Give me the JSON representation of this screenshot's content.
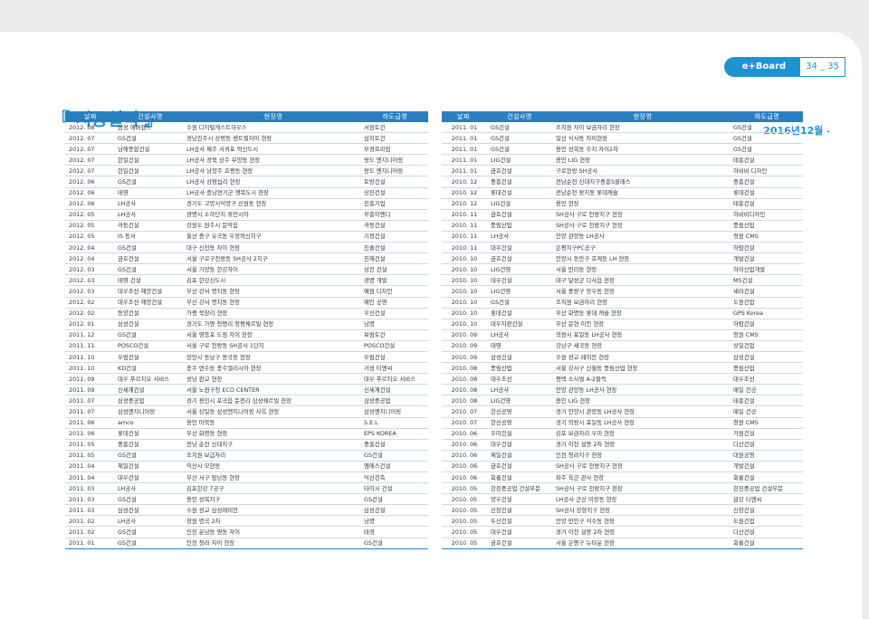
{
  "header": {
    "brand": "e+Board",
    "pages": "34 _ 35"
  },
  "title": "『 시공실적 』",
  "date": {
    "year": "2016년",
    "month": "12월",
    "suffix": "-"
  },
  "columns": [
    "날짜",
    "건설사명",
    "현장명",
    "하도급명"
  ],
  "left_rows": [
    [
      "2012. 08",
      "삼성 에버랜드",
      "수원 디지털게스트하우스",
      "서원토건"
    ],
    [
      "2012. 07",
      "GS건설",
      "경남진주시 상평동 센트럴자이 현장",
      "삼지토건"
    ],
    [
      "2012. 07",
      "남해종합건설",
      "LH공사 제주 서귀포 혁신도시",
      "부경프라임"
    ],
    [
      "2012. 07",
      "한일건설",
      "LH공사 경북 상주 무양동 현장",
      "왕도 엔지니어링"
    ],
    [
      "2012. 07",
      "한일건설",
      "LH공사 남양주 호평동 현장",
      "왕도 엔지니어링"
    ],
    [
      "2012. 06",
      "GS건설",
      "LH공사 상왕십리 현장",
      "토방건설"
    ],
    [
      "2012. 06",
      "태영",
      "LH공사 충남연기군 행복도시 현장",
      "상진건설"
    ],
    [
      "2012. 06",
      "LH공사",
      "경기도 고양시덕양구 신원동 현장",
      "진흥기업"
    ],
    [
      "2012. 05",
      "LH공사",
      "광명시 소하단지 휴먼시아",
      "부흥이엔디"
    ],
    [
      "2012. 05",
      "극동건설",
      "강원도 원주시 문막읍",
      "극동건설"
    ],
    [
      "2012. 05",
      "IS 동서",
      "울산 중구 유곡동 우정혁신지구",
      "기정건설"
    ],
    [
      "2012. 04",
      "GS건설",
      "대구 신천동 자이 현장",
      "진솔건설"
    ],
    [
      "2012. 04",
      "금호건설",
      "서울 구로구천왕동 SH공사 2지구",
      "진해건설"
    ],
    [
      "2012. 03",
      "GS건설",
      "서울 가양동 한강자이",
      "상진 건설"
    ],
    [
      "2012. 03",
      "태영 건설",
      "김포 한강신도시",
      "광명 개발"
    ],
    [
      "2012. 03",
      "대우조선 해양건설",
      "부산 강서 명지동 현장",
      "예원 디자인"
    ],
    [
      "2012. 02",
      "대우조선 해양건설",
      "부산 강서 명지동 현장",
      "예인 공영"
    ],
    [
      "2012. 02",
      "동양건설",
      "가평 북창리 현장",
      "우신건설"
    ],
    [
      "2012. 01",
      "삼성건설",
      "경기도 가평 청평리 청평쉐르빌 현장",
      "남명"
    ],
    [
      "2011. 12",
      "GS건설",
      "서울 영등포 도림 자이 현장",
      "보림토건"
    ],
    [
      "2011. 11",
      "POSCO건설",
      "서울 구로 천왕동 SH공사 1단지",
      "POSCO건설"
    ],
    [
      "2011. 10",
      "우림건설",
      "천안시 동남구 봉곡동 현장",
      "우림건설"
    ],
    [
      "2011. 10",
      "KD건설",
      "충주 연수동 충주엘리시아 현장",
      "거성 티엔씨"
    ],
    [
      "2011. 09",
      "대우 푸르지오 서비스",
      "성남 판교 현장",
      "대우 푸르지오 서비스"
    ],
    [
      "2011. 09",
      "신세계건설",
      "서울 노원구청 ECO CENTER",
      "신세계건설"
    ],
    [
      "2011. 07",
      "삼성중공업",
      "경기 용인시 포곡읍 둔전리 삼성쉐르빌 현장",
      "삼성중공업"
    ],
    [
      "2011. 07",
      "삼성엔지니어링",
      "서울 상일동 삼성엔지니어링 사옥 현장",
      "삼성엔지니어링"
    ],
    [
      "2011. 06",
      "amco",
      "용인 마북동",
      "S.E.L"
    ],
    [
      "2011. 06",
      "롯데건설",
      "부산 화명동 현장",
      "EPS KOREA"
    ],
    [
      "2011. 05",
      "중흥건설",
      "전남 순천 신대지구",
      "중흥건설"
    ],
    [
      "2011. 05",
      "GS건설",
      "조치원 보급자리",
      "GS건설"
    ],
    [
      "2011. 04",
      "제일건설",
      "익산시 모현동",
      "엠에스건설"
    ],
    [
      "2011. 04",
      "대우건설",
      "부산 서구 암남동 현장",
      "덕산건축"
    ],
    [
      "2011. 03",
      "LH공사",
      "김포한강 7공구",
      "타이시 건설"
    ],
    [
      "2011. 03",
      "GS건설",
      "용인 성복지구",
      "GS건설"
    ],
    [
      "2011. 03",
      "삼성건설",
      "수원 광교 삼성래미안",
      "삼성건설"
    ],
    [
      "2011. 02",
      "LH공사",
      "창원 명곡 2차",
      "남명"
    ],
    [
      "2011. 02",
      "GS건설",
      "인천 운남동 영동 자이",
      "태경"
    ],
    [
      "2011. 01",
      "GS건설",
      "인천 청라 자이 현장",
      "GS건설"
    ]
  ],
  "right_rows": [
    [
      "2011. 01",
      "GS건설",
      "조치원 자이 보금자리 현장",
      "GS건설"
    ],
    [
      "2011. 01",
      "GS건설",
      "일산 식사동 자이현장",
      "GS건설"
    ],
    [
      "2011. 01",
      "GS건설",
      "용인 성복동 수지 자이2차",
      "GS건설"
    ],
    [
      "2011. 01",
      "LIG건설",
      "용인 LIG 현장",
      "태흥건설"
    ],
    [
      "2011. 01",
      "금호건설",
      "구로천왕 SH공사",
      "하비비 디자인"
    ],
    [
      "2010. 12",
      "중흥건설",
      "전남순천 신대지구중흥S클래스",
      "중흥건설"
    ],
    [
      "2010. 12",
      "롯데건설",
      "전남순천 왕지동 롯데캐슬",
      "롯데건설"
    ],
    [
      "2010. 12",
      "LIG건설",
      "용인 현장",
      "태흥건설"
    ],
    [
      "2010. 11",
      "금호건설",
      "SH공사 구로 천왕지구 현장",
      "하비비디자인"
    ],
    [
      "2010. 11",
      "풍림산업",
      "SH공사 구로 천왕지구 현장",
      "풍림산업"
    ],
    [
      "2010. 11",
      "LH공사",
      "안양 관양동 LH공사",
      "청원 CMS"
    ],
    [
      "2010. 11",
      "대우건설",
      "은평지구PC공구",
      "하람건설"
    ],
    [
      "2010. 10",
      "금호건설",
      "안양시 동안구 호계동 LH 현장",
      "개발건설"
    ],
    [
      "2010. 10",
      "LIG건영",
      "서울 만리동 현장",
      "하이산업개발"
    ],
    [
      "2010. 10",
      "대우건설",
      "대구 달성군 다사읍 현장",
      "MS건설"
    ],
    [
      "2010. 10",
      "LIG건영",
      "서울 중량구 망우동 현장",
      "세라건설"
    ],
    [
      "2010. 10",
      "GS건설",
      "조치원 보금자리 현장",
      "도원건업"
    ],
    [
      "2010. 10",
      "롯데건설",
      "부산 화명동 롯데 캐슬 현장",
      "GPS Korea"
    ],
    [
      "2010. 10",
      "대우자판건설",
      "부산 문현 이안 현장",
      "하람건설"
    ],
    [
      "2010. 09",
      "LH공사",
      "의왕시 포일동 LH공사 현장",
      "청원 CMS"
    ],
    [
      "2010. 09",
      "태영",
      "강남구 세곡동 현장",
      "상일건업"
    ],
    [
      "2010. 09",
      "삼성건설",
      "수원 광교 레미안 현장",
      "삼성건설"
    ],
    [
      "2010. 08",
      "풍림산업",
      "서울 강서구 신월동 풍림산업 현장",
      "풍림산업"
    ],
    [
      "2010. 08",
      "대우조선",
      "평택 소사벌 A-2블럭",
      "대우조선"
    ],
    [
      "2010. 08",
      "LH공사",
      "안양 관양동 LH공사 현장",
      "매일 건공"
    ],
    [
      "2010. 08",
      "LIG건영",
      "용인 LIG 현장",
      "태흥건설"
    ],
    [
      "2010. 07",
      "한신공영",
      "경기 안양시 관양동 LH공사 현장",
      "매일 건공"
    ],
    [
      "2010. 07",
      "한신공영",
      "경기 의왕시 포일동 LH공사 현장",
      "청원 CMS"
    ],
    [
      "2010. 06",
      "우미건설",
      "김포 보금자리 우미 현장",
      "가원건설"
    ],
    [
      "2010. 06",
      "대우건설",
      "경기 이천 설봉 2차 현장",
      "다산건설"
    ],
    [
      "2010. 06",
      "제일건설",
      "인천 청라지구 현장",
      "대원공영"
    ],
    [
      "2010. 06",
      "금호건설",
      "SH공사 구로 천왕지구 현장",
      "개발건설"
    ],
    [
      "2010. 06",
      "회룡건설",
      "파주 육군 관사 현장",
      "회룡건설"
    ],
    [
      "2010. 05",
      "한진중공업 건설부문",
      "SH공사 구로 천왕지구 현장",
      "한진중공업 건설부문"
    ],
    [
      "2010. 05",
      "양우건설",
      "LH공사 군산 미장동 현장",
      "금강 티엔씨"
    ],
    [
      "2010. 05",
      "신창건설",
      "SH공사 장항지구 현장",
      "신창건설"
    ],
    [
      "2010. 05",
      "두산건설",
      "안양 만안구 석수동 현장",
      "도원건업"
    ],
    [
      "2010. 05",
      "대우건설",
      "경기 이천 설봉 2차 현장",
      "다산건설"
    ],
    [
      "2010. 05",
      "금호건설",
      "서울 은평구 뉴타운 현장",
      "회룡건설"
    ]
  ]
}
